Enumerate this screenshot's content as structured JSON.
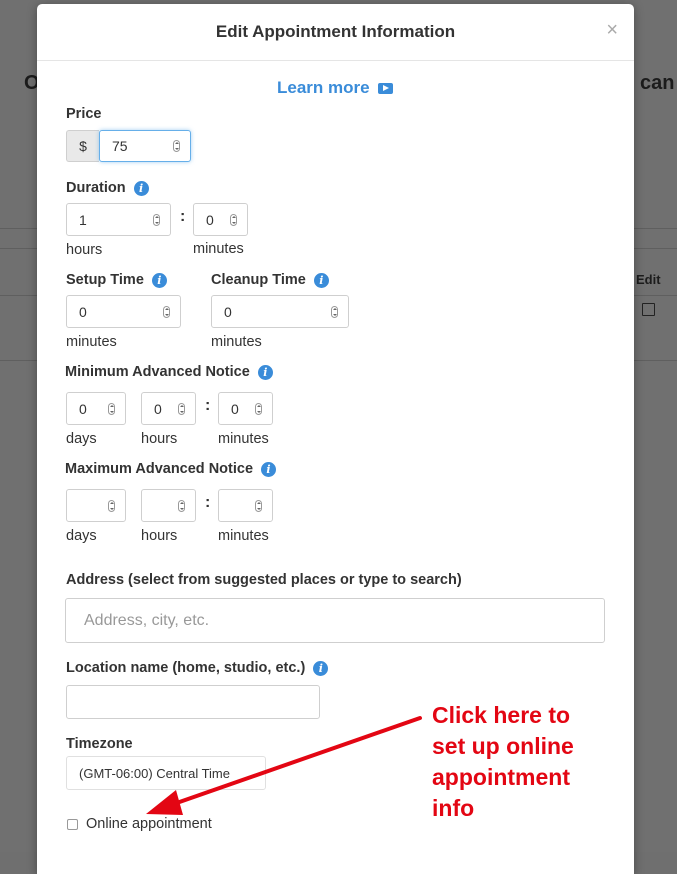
{
  "background": {
    "left_fragment": "O",
    "right_fragment": "can",
    "column_header": "Edit",
    "edit_icon": "edit-icon"
  },
  "modal": {
    "title": "Edit Appointment Information",
    "close_icon": "×",
    "learn_more": "Learn more",
    "price": {
      "label": "Price",
      "currency": "$",
      "value": "75"
    },
    "duration": {
      "label": "Duration",
      "hours_value": "1",
      "minutes_value": "0",
      "hours_label": "hours",
      "minutes_label": "minutes"
    },
    "setup_time": {
      "label": "Setup Time",
      "value": "0",
      "unit": "minutes"
    },
    "cleanup_time": {
      "label": "Cleanup Time",
      "value": "0",
      "unit": "minutes"
    },
    "min_notice": {
      "label": "Minimum Advanced Notice",
      "days": "0",
      "hours": "0",
      "minutes": "0",
      "days_label": "days",
      "hours_label": "hours",
      "minutes_label": "minutes"
    },
    "max_notice": {
      "label": "Maximum Advanced Notice",
      "days": "",
      "hours": "",
      "minutes": "",
      "days_label": "days",
      "hours_label": "hours",
      "minutes_label": "minutes"
    },
    "address": {
      "label": "Address (select from suggested places or type to search)",
      "placeholder": "Address, city, etc."
    },
    "location_name": {
      "label": "Location name (home, studio, etc.)",
      "value": ""
    },
    "timezone": {
      "label": "Timezone",
      "value": "(GMT-06:00) Central Time"
    },
    "online": {
      "label": "Online appointment",
      "checked": false
    }
  },
  "annotation": {
    "text": "Click here to\nset up online\nappointment\ninfo",
    "color": "#e30613"
  },
  "colors": {
    "accent": "#3a8cd9",
    "overlay": "#707070"
  }
}
